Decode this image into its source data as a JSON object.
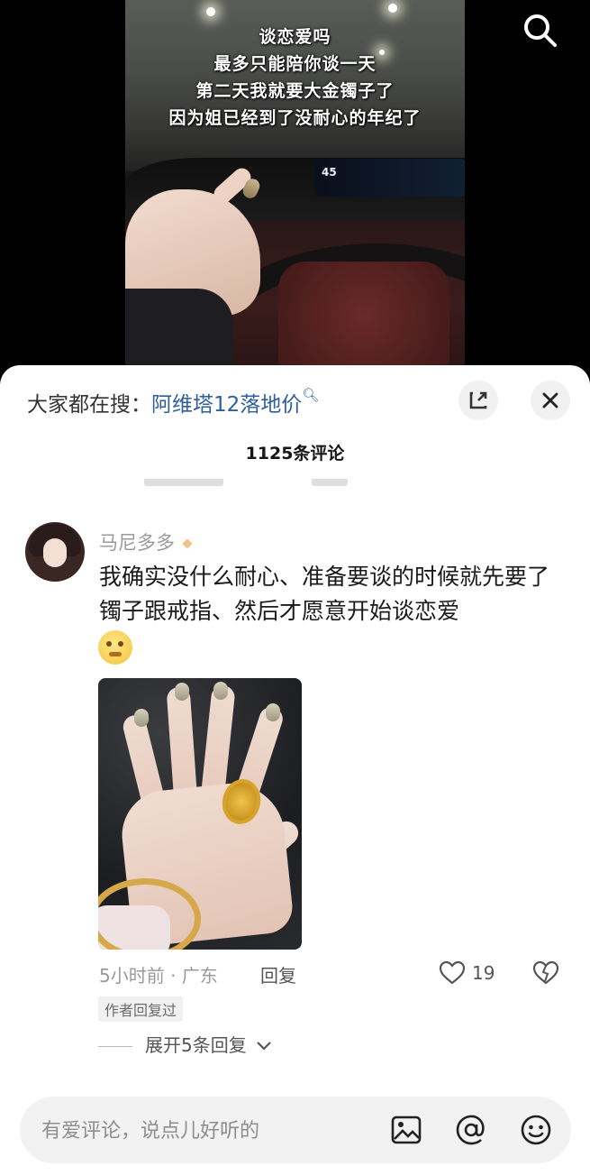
{
  "video": {
    "overlay_lines": [
      "谈恋爱吗",
      "最多只能陪你谈一天",
      "第二天我就要大金镯子了",
      "因为姐已经到了没耐心的年纪了"
    ],
    "speed_readout": "45"
  },
  "comments_panel": {
    "hot_search_label": "大家都在搜：",
    "hot_search_term": "阿维塔12落地价",
    "comment_count": "1125条评论",
    "comment": {
      "username": "马尼多多",
      "text": "我确实没什么耐心、准备要谈的时候就先要了镯子跟戒指、然后才愿意开始谈恋爱",
      "meta": "5小时前 · 广东",
      "reply_label": "回复",
      "like_count": "19",
      "author_badge": "作者回复过",
      "expand_label": "展开5条回复"
    },
    "input": {
      "placeholder": "有爱评论，说点儿好听的"
    }
  },
  "icons": [
    "search-icon",
    "fullscreen-icon",
    "close-icon",
    "diamond-icon",
    "emoji-icon",
    "heart-icon",
    "broken-heart-icon",
    "chevron-down-icon",
    "image-icon",
    "at-icon",
    "smile-icon"
  ]
}
